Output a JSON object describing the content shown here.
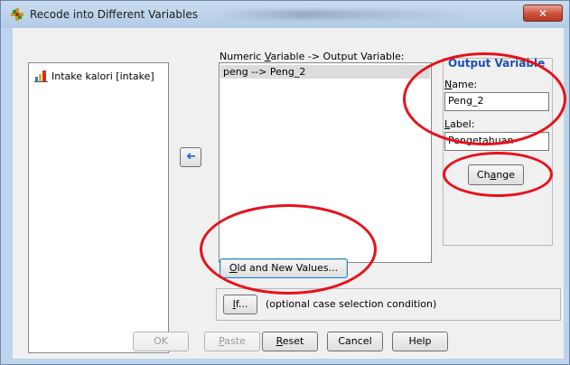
{
  "window": {
    "title": "Recode into Different Variables",
    "close_glyph": "✕"
  },
  "source_list": {
    "items": [
      {
        "label": "Intake kalori [intake]",
        "icon": "scale-variable-icon"
      }
    ]
  },
  "transfer": {
    "arrow_glyph": "➜"
  },
  "mapping": {
    "header_pre": "Numeric ",
    "header_u": "V",
    "header_post": "ariable -> Output Variable:",
    "items": [
      "peng --> Peng_2"
    ]
  },
  "output_variable": {
    "title": "Output Variable",
    "name_label_u": "N",
    "name_label_rest": "ame:",
    "name_value": "Peng_2",
    "label_label_u": "L",
    "label_label_rest": "abel:",
    "label_value": "Pengetahuan",
    "change_pre": "Ch",
    "change_u": "a",
    "change_post": "nge"
  },
  "old_new": {
    "u": "O",
    "rest": "ld and New Values..."
  },
  "if": {
    "u": "I",
    "rest": "f...",
    "condition_text": "(optional case selection condition)"
  },
  "bottom": {
    "ok": "OK",
    "paste_u": "P",
    "paste_rest": "aste",
    "reset_u": "R",
    "reset_rest": "eset",
    "cancel": "Cancel",
    "help": "Help"
  },
  "colors": {
    "annotation": "#e8101a",
    "selection": "#dcdcdc"
  }
}
